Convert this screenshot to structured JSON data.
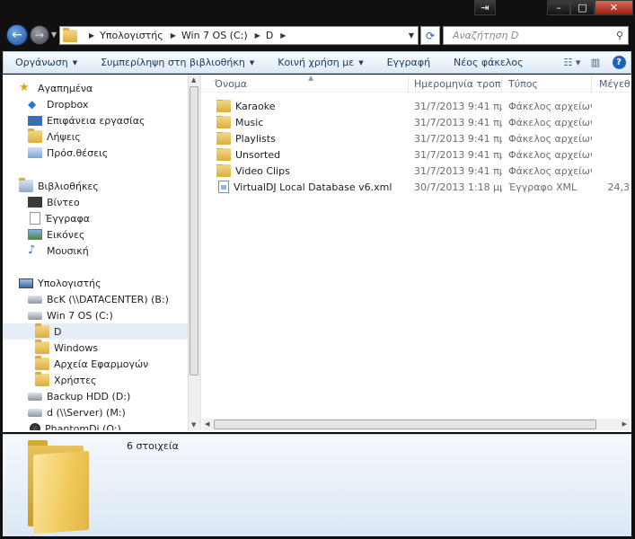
{
  "window": {
    "caption_icons": [
      "restore-window-icon",
      "minimize-icon",
      "maximize-icon",
      "close-icon"
    ]
  },
  "address": {
    "crumbs": [
      "Υπολογιστής",
      "Win 7 OS (C:)",
      "D"
    ],
    "search_placeholder": "Αναζήτηση D"
  },
  "toolbar": {
    "organize": "Οργάνωση",
    "include_library": "Συμπερίληψη στη βιβλιοθήκη",
    "share": "Κοινή χρήση με",
    "burn": "Εγγραφή",
    "new_folder": "Νέος φάκελος"
  },
  "nav": {
    "favorites": "Αγαπημένα",
    "fav_items": [
      "Dropbox",
      "Επιφάνεια εργασίας",
      "Λήψεις",
      "Πρόσ.θέσεις"
    ],
    "libraries": "Βιβλιοθήκες",
    "lib_items": [
      "Βίντεο",
      "Έγγραφα",
      "Εικόνες",
      "Μουσική"
    ],
    "computer": "Υπολογιστής",
    "drives": [
      "BcK (\\\\DATACENTER) (B:)",
      "Win 7 OS (C:)"
    ],
    "folders": [
      "D",
      "Windows",
      "Αρχεία Εφαρμογών",
      "Χρήστες"
    ],
    "more_drives": [
      "Backup HDD (D:)",
      "d (\\\\Server) (M:)",
      "PhantomDj (O:)"
    ]
  },
  "columns": [
    "Όνομα",
    "Ημερομηνία τροπ...",
    "Τύπος",
    "Μέγεθ"
  ],
  "files": [
    {
      "name": "Karaoke",
      "date": "31/7/2013 9:41 πμ",
      "type": "Φάκελος αρχείων",
      "size": ""
    },
    {
      "name": "Music",
      "date": "31/7/2013 9:41 πμ",
      "type": "Φάκελος αρχείων",
      "size": ""
    },
    {
      "name": "Playlists",
      "date": "31/7/2013 9:41 πμ",
      "type": "Φάκελος αρχείων",
      "size": ""
    },
    {
      "name": "Unsorted",
      "date": "31/7/2013 9:41 πμ",
      "type": "Φάκελος αρχείων",
      "size": ""
    },
    {
      "name": "Video Clips",
      "date": "31/7/2013 9:41 πμ",
      "type": "Φάκελος αρχείων",
      "size": ""
    },
    {
      "name": "VirtualDJ Local Database v6.xml",
      "date": "30/7/2013 1:18 μμ",
      "type": "Έγγραφο XML",
      "size": "24,3"
    }
  ],
  "details": {
    "count": "6 στοιχεία"
  }
}
